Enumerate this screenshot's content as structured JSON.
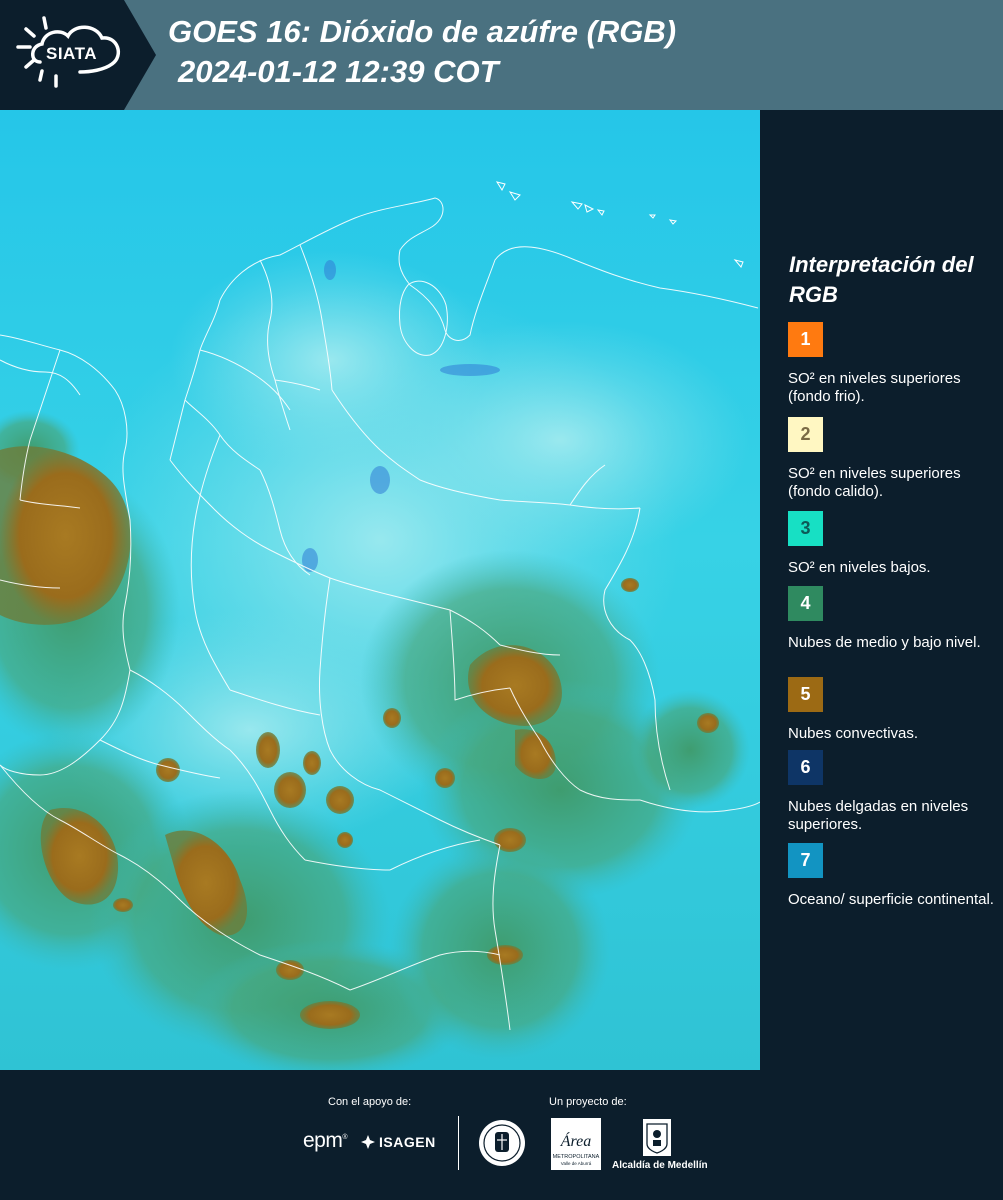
{
  "header": {
    "logo_text": "SIATA",
    "title_line1": "GOES 16: Dióxido de azúfre (RGB)",
    "title_line2": "2024-01-12 12:39 COT"
  },
  "legend": {
    "title": "Interpretación del RGB",
    "items": [
      {
        "number": "1",
        "description": "SO² en niveles superiores (fondo frio).",
        "color": "#ff7a10"
      },
      {
        "number": "2",
        "description": "SO² en niveles superiores (fondo calido).",
        "color": "#fff7c2"
      },
      {
        "number": "3",
        "description": "SO² en niveles bajos.",
        "color": "#17e0c4"
      },
      {
        "number": "4",
        "description": "Nubes de medio y bajo nivel.",
        "color": "#2f8a60"
      },
      {
        "number": "5",
        "description": "Nubes convectivas.",
        "color": "#9c6a14"
      },
      {
        "number": "6",
        "description": "Nubes delgadas en niveles superiores.",
        "color": "#0e3566"
      },
      {
        "number": "7",
        "description": "Oceano/ superficie continental.",
        "color": "#1294c2"
      }
    ]
  },
  "footer": {
    "support_label": "Con el apoyo de:",
    "project_label": "Un proyecto de:",
    "epm_text": "epm",
    "isagen_text": "ISAGEN",
    "area_text": "Área",
    "area_subtitle": "METROPOLITANA",
    "area_subtitle2": "Valle de Aburrá",
    "alcaldia_text": "Alcaldía de Medellín"
  }
}
